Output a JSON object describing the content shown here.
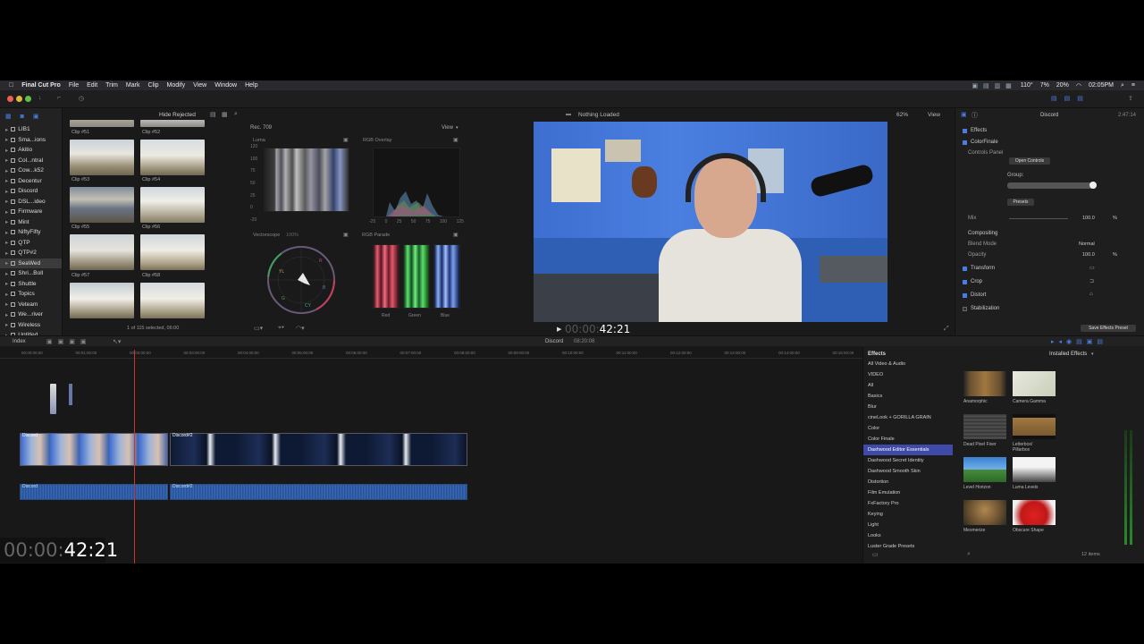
{
  "menubar": {
    "app_name": "Final Cut Pro",
    "items": [
      "File",
      "Edit",
      "Trim",
      "Mark",
      "Clip",
      "Modify",
      "View",
      "Window",
      "Help"
    ],
    "status_temp": "110°",
    "status_pct1": "7%",
    "status_pct2": "20%",
    "clock": "02:05PM"
  },
  "browser_toolbar": {
    "filter_label": "Hide Rejected"
  },
  "library": {
    "items": [
      {
        "label": "LIB1"
      },
      {
        "label": "Sma...ions"
      },
      {
        "label": "Akitio"
      },
      {
        "label": "Col...ntral"
      },
      {
        "label": "Cow...k52"
      },
      {
        "label": "Decentur"
      },
      {
        "label": "Discord"
      },
      {
        "label": "DSL...ideo"
      },
      {
        "label": "Firmware"
      },
      {
        "label": "Mint"
      },
      {
        "label": "NiftyFifty"
      },
      {
        "label": "QTP"
      },
      {
        "label": "QTP#2"
      },
      {
        "label": "SeaWed"
      },
      {
        "label": "Shri...Boll"
      },
      {
        "label": "Shuttle"
      },
      {
        "label": "Topics"
      },
      {
        "label": "Veteam"
      },
      {
        "label": "We...river"
      },
      {
        "label": "Wireless"
      },
      {
        "label": "Untitled"
      }
    ],
    "selected_index": 13
  },
  "browser": {
    "clips": [
      "Clip #51",
      "Clip #52",
      "Clip #53",
      "Clip #54",
      "Clip #55",
      "Clip #56",
      "Clip #57",
      "Clip #58"
    ],
    "status": "1 of 115 selected, 06:00"
  },
  "scopes": {
    "header": "Rec. 709",
    "view_label": "View",
    "luma_title": "Luma",
    "luma_ticks": [
      "120",
      "100",
      "75",
      "50",
      "25",
      "0",
      "-20"
    ],
    "rgb_overlay_title": "RGB Overlay",
    "vectorscope_title": "Vectorscope",
    "vectorscope_zoom": "100%",
    "rgb_parade_title": "RGB Parade",
    "parade_labels": [
      "Red",
      "Green",
      "Blue"
    ],
    "overlay_axis": [
      "-25",
      "0",
      "25",
      "50",
      "75",
      "100",
      "125"
    ]
  },
  "viewer": {
    "status": "Nothing Loaded",
    "zoom": "62%",
    "view_label": "View",
    "timecode": "42:21"
  },
  "inspector": {
    "title": "Discord",
    "duration": "2:47:14",
    "effects_label": "Effects",
    "colorfinale_label": "ColorFinale",
    "controls_panel_label": "Controls Panel",
    "open_controls_label": "Open Controls",
    "group_label": "Group:",
    "presets_label": "Presets",
    "mix_label": "Mix",
    "mix_value": "100.0",
    "pct": "%",
    "compositing_label": "Compositing",
    "blend_mode_label": "Blend Mode",
    "blend_mode_value": "Normal",
    "opacity_label": "Opacity",
    "opacity_value": "100.0",
    "transform_label": "Transform",
    "crop_label": "Crop",
    "distort_label": "Distort",
    "stabilization_label": "Stabilization",
    "save_preset_label": "Save Effects Preset"
  },
  "timeline_bar": {
    "index_label": "Index",
    "project_name": "Discord",
    "project_duration": "08:20:08"
  },
  "timeline": {
    "ruler": [
      "00:00:00:00",
      "00:01:00:00",
      "00:02:00:00",
      "00:03:00:00",
      "00:04:00:00",
      "00:05:00:00",
      "00:06:00:00",
      "00:07:00:00",
      "00:08:00:00",
      "00:09:00:00",
      "00:10:00:00",
      "00:11:00:00",
      "00:12:00:00",
      "00:13:00:00",
      "00:14:00:00",
      "00:15:00:00"
    ],
    "clip1_label": "Discord",
    "clip2_label": "Discord#2",
    "audio1_label": "Discord",
    "audio2_label": "Discord#2",
    "playhead_fraction": 0.155
  },
  "effects_browser": {
    "title": "Effects",
    "installed_label": "Installed Effects",
    "categories": [
      "All Video & Audio",
      "VIDEO",
      "All",
      "Basics",
      "Blur",
      "cineLook + GORILLA GRAIN",
      "Color",
      "Color Finale",
      "Dashwood Editor Essentials",
      "Dashwood Secret Identity",
      "Dashwood Smooth Skin",
      "Distortion",
      "Film Emulation",
      "FxFactory Pro",
      "Keying",
      "Light",
      "Looks",
      "Luster Grade Presets"
    ],
    "selected_category": "Dashwood Editor Essentials",
    "items": [
      "Anamorphic",
      "Camera Gamma",
      "Dead Pixel Fixer",
      "Letterbox/ Pillarbox",
      "Level Horizon",
      "Luma Levels",
      "Mesmerize",
      "Obscure Shape"
    ],
    "count": "12 items"
  },
  "big_timecode": {
    "dim": "00:00:",
    "bright": "42:21"
  }
}
